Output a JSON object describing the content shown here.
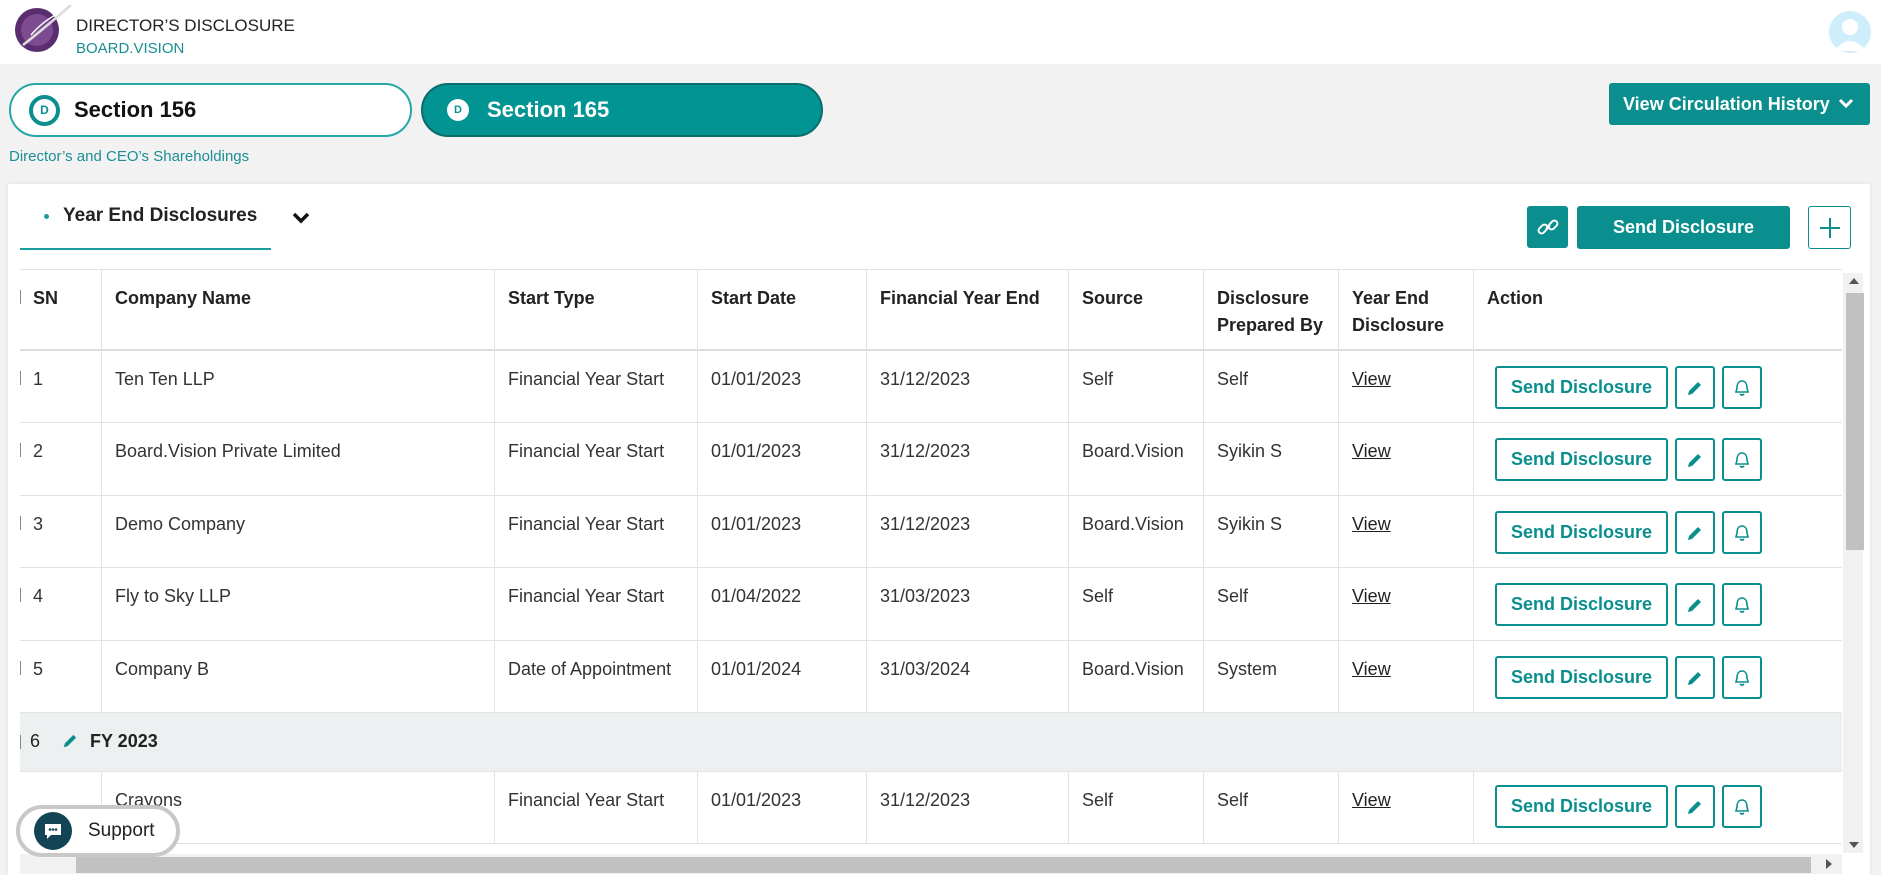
{
  "header": {
    "app_title": "DIRECTOR’S DISCLOSURE",
    "app_subtitle": "BOARD.VISION",
    "logo_icon": "feather-logo-icon",
    "avatar_icon": "user-avatar-icon"
  },
  "sections": {
    "tab1": {
      "badge": "D",
      "label": "Section 156"
    },
    "tab2": {
      "badge": "D",
      "label": "Section 165"
    },
    "description": "Director’s and CEO’s Shareholdings"
  },
  "toolbar": {
    "circulation_label": "View Circulation History",
    "subtab_label": "Year End Disclosures",
    "send_label": "Send Disclosure"
  },
  "table": {
    "headers": {
      "sn": "SN",
      "company": "Company Name",
      "start_type": "Start Type",
      "start_date": "Start Date",
      "fye": "Financial Year End",
      "source": "Source",
      "prepared": "Disclosure Prepared By",
      "yed": "Year End Disclosure",
      "action": "Action"
    },
    "rows": [
      {
        "sn": "1",
        "company": "Ten Ten LLP",
        "start_type": "Financial Year Start",
        "start_date": "01/01/2023",
        "fye": "31/12/2023",
        "source": "Self",
        "prepared": "Self",
        "yed": "View",
        "send": "Send Disclosure"
      },
      {
        "sn": "2",
        "company": "Board.Vision Private Limited",
        "start_type": "Financial Year Start",
        "start_date": "01/01/2023",
        "fye": "31/12/2023",
        "source": "Board.Vision",
        "prepared": "Syikin S",
        "yed": "View",
        "send": "Send Disclosure"
      },
      {
        "sn": "3",
        "company": "Demo Company",
        "start_type": "Financial Year Start",
        "start_date": "01/01/2023",
        "fye": "31/12/2023",
        "source": "Board.Vision",
        "prepared": "Syikin S",
        "yed": "View",
        "send": "Send Disclosure"
      },
      {
        "sn": "4",
        "company": "Fly to Sky LLP",
        "start_type": "Financial Year Start",
        "start_date": "01/04/2022",
        "fye": "31/03/2023",
        "source": "Self",
        "prepared": "Self",
        "yed": "View",
        "send": "Send Disclosure"
      },
      {
        "sn": "5",
        "company": "Company B",
        "start_type": "Date of Appointment",
        "start_date": "01/01/2024",
        "fye": "31/03/2024",
        "source": "Board.Vision",
        "prepared": "System",
        "yed": "View",
        "send": "Send Disclosure"
      }
    ],
    "group": {
      "sn": "6",
      "label": "FY 2023"
    },
    "group_row": {
      "company": "Crayons",
      "start_type": "Financial Year Start",
      "start_date": "01/01/2023",
      "fye": "31/12/2023",
      "source": "Self",
      "prepared": "Self",
      "yed": "View",
      "send": "Send Disclosure"
    }
  },
  "support": {
    "label": "Support",
    "icon": "chat-bubble-icon"
  },
  "colors": {
    "accent": "#0b8e8e",
    "link": "#1a8e93"
  }
}
